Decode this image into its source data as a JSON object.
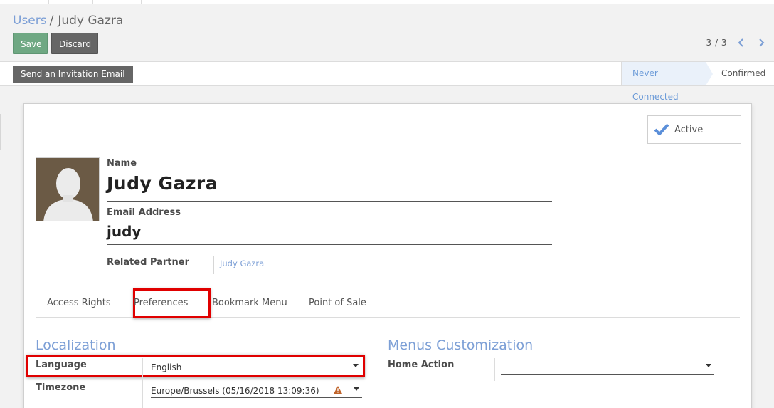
{
  "breadcrumb": {
    "parent": "Users",
    "separator": "/",
    "current": "Judy Gazra"
  },
  "toolbar": {
    "save_label": "Save",
    "discard_label": "Discard"
  },
  "pager": {
    "value": "3 / 3"
  },
  "statusbar": {
    "invite_label": "Send an Invitation Email",
    "stages": [
      {
        "label": "Never Connected",
        "current": true
      },
      {
        "label": "Confirmed",
        "current": false
      }
    ]
  },
  "form": {
    "active_label": "Active",
    "name_label": "Name",
    "name_value": "Judy Gazra",
    "email_label": "Email Address",
    "email_value": "judy",
    "partner_label": "Related Partner",
    "partner_value": "Judy Gazra"
  },
  "tabs": [
    {
      "label": "Access Rights"
    },
    {
      "label": "Preferences",
      "highlighted": true
    },
    {
      "label": "Bookmark Menu"
    },
    {
      "label": "Point of Sale"
    }
  ],
  "preferences": {
    "localization_title": "Localization",
    "language_label": "Language",
    "language_value": "English",
    "timezone_label": "Timezone",
    "timezone_value": "Europe/Brussels (05/16/2018 13:09:36)",
    "menus_title": "Menus Customization",
    "home_action_label": "Home Action",
    "home_action_value": ""
  },
  "colors": {
    "accent": "#7c9fd6",
    "save": "#6fa883",
    "highlight": "#e00000",
    "dark_button": "#666666"
  }
}
